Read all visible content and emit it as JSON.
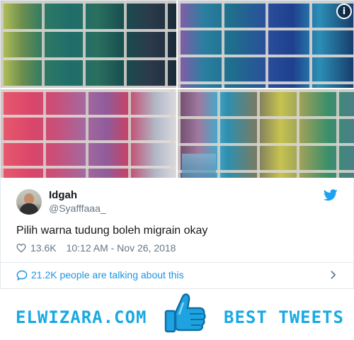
{
  "tweet": {
    "display_name": "Idgah",
    "handle": "@Syafffaaa_",
    "text": "Pilih warna tudung boleh migrain okay",
    "likes": "13.6K",
    "timestamp": "10:12 AM - Nov 26, 2018",
    "talking": "21.2K people are talking about this",
    "info_glyph": "i"
  },
  "footer": {
    "brand": "ELWIZARA.COM",
    "tagline": "BEST TWEETS"
  },
  "colors": {
    "accent": "#1b95e0",
    "brand": "#19a9e3"
  },
  "icons": [
    "info-icon",
    "twitter-bird-icon",
    "heart-icon",
    "speech-bubble-icon",
    "chevron-right-icon",
    "thumbs-up-icon"
  ]
}
